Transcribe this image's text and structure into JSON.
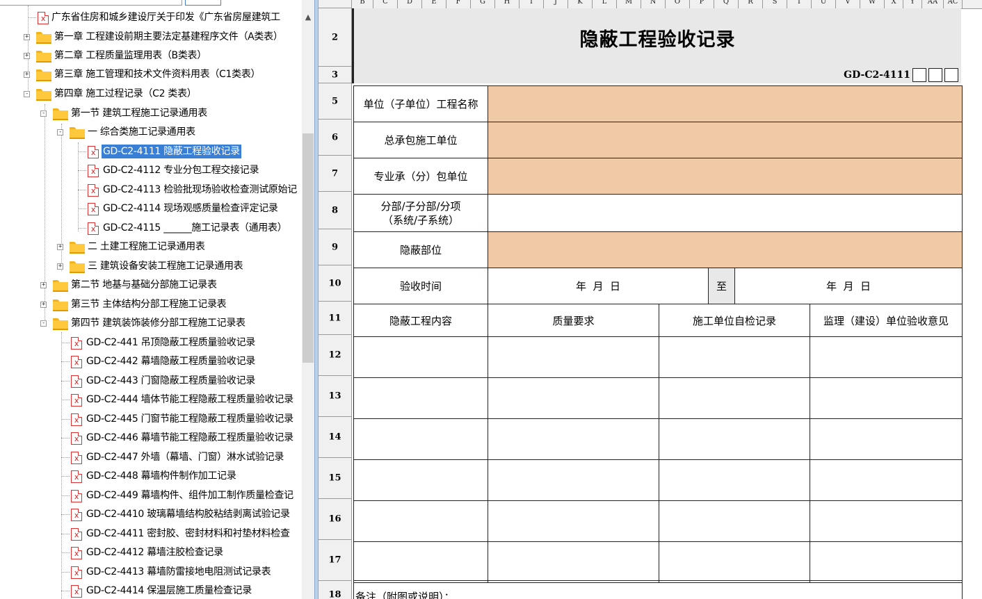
{
  "tree": {
    "items": [
      {
        "label": "广东省住房和城乡建设厅关于印发《广东省房屋建筑工"
      },
      {
        "label": "第一章 工程建设前期主要法定基建程序文件（A类表）"
      },
      {
        "label": "第二章 工程质量监理用表（B类表）"
      },
      {
        "label": "第三章 施工管理和技术文件资料用表（C1类表）"
      },
      {
        "label": "第四章 施工过程记录（C2 类表）"
      },
      {
        "label": "第一节 建筑工程施工记录通用表"
      },
      {
        "label": "一 综合类施工记录通用表"
      },
      {
        "label": "GD-C2-4111 隐蔽工程验收记录"
      },
      {
        "label": "GD-C2-4112 专业分包工程交接记录"
      },
      {
        "label": "GD-C2-4113 检验批现场验收检查测试原始记"
      },
      {
        "label": "GD-C2-4114 现场观感质量检查评定记录"
      },
      {
        "label": "GD-C2-4115 ______施工记录表（通用表）"
      },
      {
        "label": "二 土建工程施工记录通用表"
      },
      {
        "label": "三 建筑设备安装工程施工记录通用表"
      },
      {
        "label": "第二节 地基与基础分部施工记录表"
      },
      {
        "label": "第三节 主体结构分部工程施工记录表"
      },
      {
        "label": "第四节 建筑装饰装修分部工程施工记录表"
      },
      {
        "label": "GD-C2-441 吊顶隐蔽工程质量验收记录"
      },
      {
        "label": "GD-C2-442 幕墙隐蔽工程质量验收记录"
      },
      {
        "label": "GD-C2-443 门窗隐蔽工程质量验收记录"
      },
      {
        "label": "GD-C2-444 墙体节能工程隐蔽工程质量验收记录"
      },
      {
        "label": "GD-C2-445 门窗节能工程隐蔽工程质量验收记录"
      },
      {
        "label": "GD-C2-446 幕墙节能工程隐蔽工程质量验收记录"
      },
      {
        "label": "GD-C2-447 外墙（幕墙、门窗）淋水试验记录"
      },
      {
        "label": "GD-C2-448 幕墙构件制作加工记录"
      },
      {
        "label": "GD-C2-449 幕墙构件、组件加工制作质量检查记"
      },
      {
        "label": "GD-C2-4410 玻璃幕墙结构胶粘结剥离试验记录"
      },
      {
        "label": "GD-C2-4411 密封胶、密封材料和衬垫材料检查"
      },
      {
        "label": "GD-C2-4412 幕墙注胶检查记录"
      },
      {
        "label": "GD-C2-4413 幕墙防雷接地电阻测试记录表"
      },
      {
        "label": "GD-C2-4414 保温层施工质量检查记录"
      }
    ]
  },
  "sheet": {
    "columns": [
      "B",
      "C",
      "D",
      "E",
      "F",
      "G",
      "H",
      "I",
      "J",
      "K",
      "L",
      "M",
      "N",
      "O",
      "P",
      "Q",
      "R",
      "S",
      "T",
      "U",
      "V",
      "W",
      "X",
      "Y",
      "AA",
      "AC"
    ],
    "rows": [
      "2",
      "3",
      "5",
      "6",
      "7",
      "8",
      "9",
      "10",
      "11",
      "12",
      "13",
      "14",
      "15",
      "16",
      "17",
      "18"
    ],
    "title": "隐蔽工程验收记录",
    "code": "GD-C2-4111",
    "labels": {
      "project_name": "单位（子单位）工程名称",
      "general_contractor": "总承包施工单位",
      "sub_contractor": "专业承（分）包单位",
      "division_line1": "分部/子分部/分项",
      "division_line2": "（系统/子系统）",
      "hidden_location": "隐蔽部位",
      "acceptance_time": "验收时间",
      "date_from": "年  月  日",
      "to": "至",
      "date_to": "年  月  日",
      "remarks": "备注（附图或说明）："
    },
    "table_headers": [
      "隐蔽工程内容",
      "质量要求",
      "施工单位自检记录",
      "监理（建设）单位验收意见"
    ],
    "colors": {
      "peach": "#f0caa6",
      "gray": "#e8e8e8",
      "selection": "#3a7fd6"
    }
  }
}
